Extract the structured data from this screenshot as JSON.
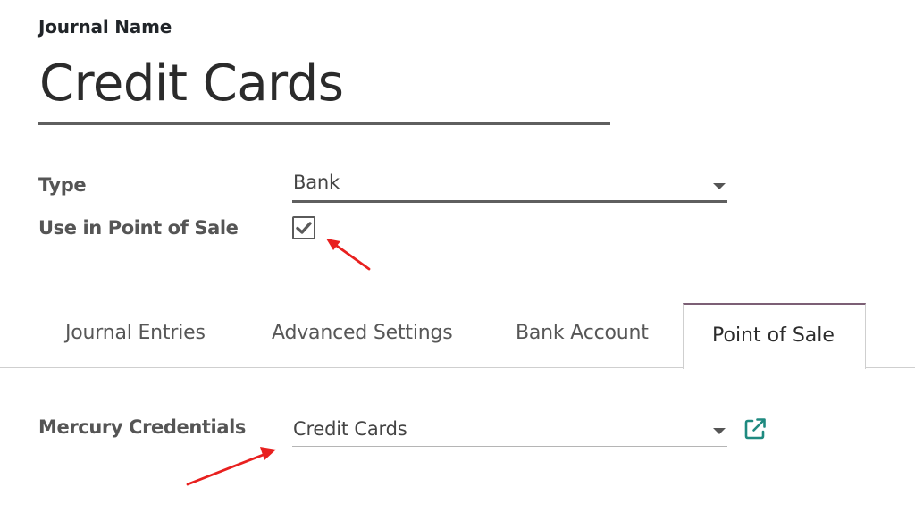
{
  "journal": {
    "label": "Journal Name",
    "name": "Credit Cards"
  },
  "fields": {
    "type": {
      "label": "Type",
      "value": "Bank"
    },
    "use_in_pos": {
      "label": "Use in Point of Sale",
      "checked": true
    }
  },
  "tabs": [
    {
      "label": "Journal Entries",
      "active": false
    },
    {
      "label": "Advanced Settings",
      "active": false
    },
    {
      "label": "Bank Account",
      "active": false
    },
    {
      "label": "Point of Sale",
      "active": true
    }
  ],
  "pos_tab": {
    "mercury": {
      "label": "Mercury Credentials",
      "value": "Credit Cards"
    }
  },
  "colors": {
    "annotation_arrow": "#e8201f",
    "active_tab_accent": "#7c5f75",
    "external_link_icon": "#1f8a80"
  },
  "icons": {
    "checkbox": "check-icon",
    "dropdown": "caret-down-icon",
    "external": "external-link-icon",
    "annotation": "arrow-icon"
  }
}
